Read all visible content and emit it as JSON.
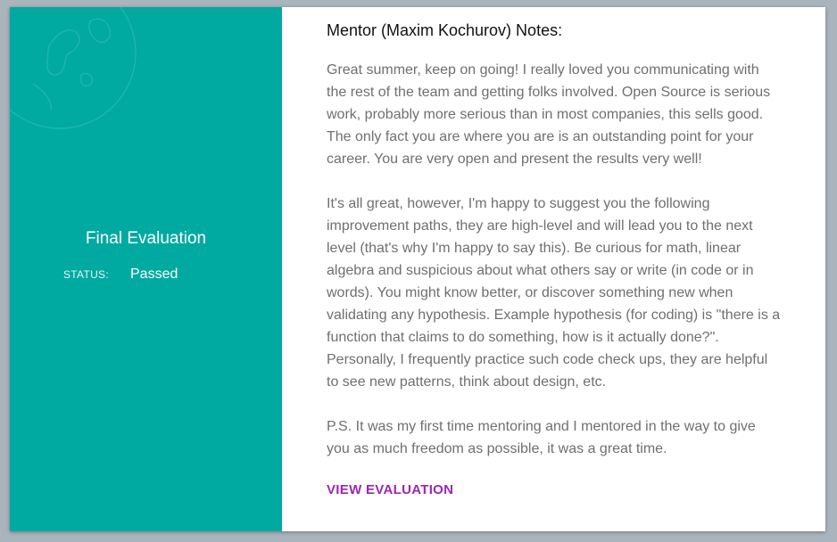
{
  "left_panel": {
    "title": "Final Evaluation",
    "status_label": "STATUS:",
    "status_value": "Passed",
    "background_color": "#00aaa0",
    "decoration_icon": "globe-icon"
  },
  "notes": {
    "heading": "Mentor (Maxim Kochurov) Notes:",
    "paragraphs": [
      "Great summer, keep on going! I really loved you communicating with the rest of the team and getting folks involved. Open Source is serious work, probably more serious than in most companies, this sells good. The only fact you are where you are is an outstanding point for your career. You are very open and present the results very well!",
      "It's all great, however, I'm happy to suggest you the following improvement paths, they are high-level and will lead you to the next level (that's why I'm happy to say this). Be curious for math, linear algebra and suspicious about what others say or write (in code or in words). You might know better, or discover something new when validating any hypothesis. Example hypothesis (for coding) is \"there is a function that claims to do something, how is it actually done?\". Personally, I frequently practice such code check ups, they are helpful to see new patterns, think about design, etc.",
      "P.S. It was my first time mentoring and I mentored in the way to give you as much freedom as possible, it was a great time."
    ],
    "link_label": "VIEW EVALUATION",
    "link_color": "#9c27b0"
  }
}
